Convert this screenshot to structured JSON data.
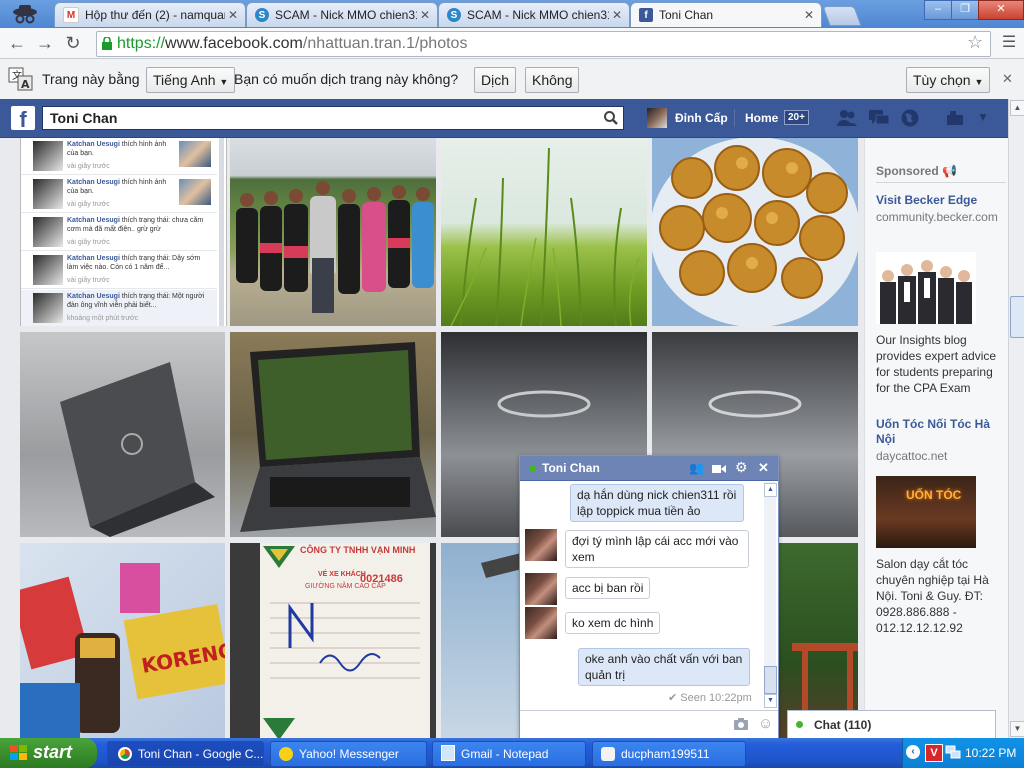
{
  "browser": {
    "tabs": [
      {
        "title": "Hộp thư đến (2) - namquang",
        "favicon": "gmail-icon"
      },
      {
        "title": "SCAM - Nick MMO chien311",
        "favicon": "s-icon"
      },
      {
        "title": "SCAM - Nick MMO chien311",
        "favicon": "s-icon"
      },
      {
        "title": "Toni Chan",
        "favicon": "facebook-icon",
        "active": true
      }
    ],
    "url_scheme": "https://",
    "url_host": "www.facebook.com",
    "url_path": "/nhattuan.tran.1/photos"
  },
  "translate_bar": {
    "text1": "Trang này bằng",
    "language": "Tiếng Anh",
    "text2": "Bạn có muốn dịch trang này không?",
    "translate_button": "Dịch",
    "no_button": "Không",
    "options_button": "Tùy chọn"
  },
  "facebook": {
    "logo": "f",
    "search_value": "Toni Chan",
    "user_name": "Đỉnh Cấp",
    "home_label": "Home",
    "home_count": "20+",
    "colors": {
      "brand": "#3b5998",
      "link": "#3b5998"
    }
  },
  "activity": [
    {
      "name": "Katchan Uesugi",
      "text": "thích hình ảnh của bạn.",
      "time": "vài giây trước"
    },
    {
      "name": "Katchan Uesugi",
      "text": "thích hình ảnh của bạn.",
      "time": "vài giây trước"
    },
    {
      "name": "Katchan Uesugi",
      "text": "thích trạng thái: chưa cắm cơm mà đã mất điện.. grừ grừ",
      "time": "vài giây trước"
    },
    {
      "name": "Katchan Uesugi",
      "text": "thích trạng thái: Dậy sớm làm việc nào. Còn có 1 năm để...",
      "time": "vài giây trước"
    },
    {
      "name": "Katchan Uesugi",
      "text": "thích trạng thái: Một người đàn ông vĩnh viễn phải biết...",
      "time": "khoảng một phút trước"
    }
  ],
  "sponsored": {
    "header": "Sponsored",
    "ads": [
      {
        "title": "Visit Becker Edge",
        "url": "community.becker.com",
        "body": "Our Insights blog provides expert advice for students preparing for the CPA Exam"
      },
      {
        "title": "Uốn Tóc Nối Tóc Hà Nội",
        "url": "daycattoc.net",
        "image_text": "UỐN TÓC",
        "body": "Salon dạy cắt tóc chuyên nghiệp tại Hà Nội. Toni & Guy. ĐT: 0928.886.888 - 012.12.12.12.92"
      }
    ]
  },
  "receipt": {
    "company": "CÔNG TY TNHH VẠN MINH",
    "ticket": "VÉ XE KHÁCH",
    "seat": "GIƯỜNG NẰM CAO CẤP",
    "number": "0021486"
  },
  "chat": {
    "name": "Toni Chan",
    "messages": [
      {
        "from": "me",
        "text": "dạ hắn dùng nick chien311 rồi lập toppick mua tiền ảo"
      },
      {
        "from": "them",
        "text": "đợi tý mình lập cái acc mới vào xem"
      },
      {
        "from": "them",
        "text": "acc bị ban rồi"
      },
      {
        "from": "them",
        "text": "ko xem dc hình"
      },
      {
        "from": "me",
        "text": "oke anh vào chất vấn với ban quản trị"
      }
    ],
    "seen": "Seen 10:22pm",
    "sidebar_label": "Chat (110)"
  },
  "taskbar": {
    "start": "start",
    "items": [
      {
        "label": "Toni Chan - Google C...",
        "icon": "chrome-icon"
      },
      {
        "label": "Yahoo! Messenger",
        "icon": "yahoo-icon"
      },
      {
        "label": "Gmail - Notepad",
        "icon": "notepad-icon"
      },
      {
        "label": "ducpham199511",
        "icon": "messenger-icon"
      }
    ],
    "clock": "10:22 PM"
  }
}
